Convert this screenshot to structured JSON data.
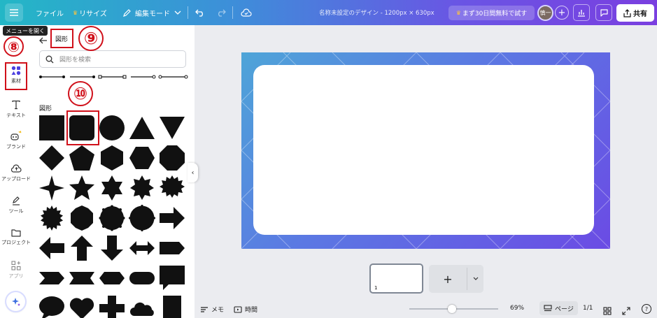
{
  "topbar": {
    "file_label": "ファイル",
    "resize_label": "リサイズ",
    "edit_mode_label": "編集モード",
    "design_title": "名称未設定のデザイン - 1200px × 630px",
    "trial_label": "まず30日間無料で試す",
    "avatar_text": "慎一",
    "share_label": "共有",
    "tooltip": "メニューを開く",
    "gradient": [
      "#23b7c6",
      "#7a3fe0"
    ]
  },
  "rail": {
    "items": [
      {
        "label": "素材",
        "icon": "elements-icon"
      },
      {
        "label": "テキスト",
        "icon": "text-icon"
      },
      {
        "label": "ブランド",
        "icon": "brand-icon"
      },
      {
        "label": "アップロード",
        "icon": "upload-icon"
      },
      {
        "label": "ツール",
        "icon": "pen-tool-icon"
      },
      {
        "label": "プロジェクト",
        "icon": "folder-icon"
      },
      {
        "label": "アプリ",
        "icon": "apps-icon"
      }
    ]
  },
  "panel": {
    "title": "図形",
    "search_placeholder": "図形を検索",
    "section_title": "図形"
  },
  "annotations": {
    "n8": "⑧",
    "n9": "⑨",
    "n10": "⑩",
    "color": "#d0101a"
  },
  "bottom": {
    "notes_label": "メモ",
    "timer_label": "時間",
    "zoom_value": "69%",
    "zoom_fraction": 0.48,
    "page_label": "ページ",
    "page_count": "1/1",
    "thumb_number": "1"
  }
}
